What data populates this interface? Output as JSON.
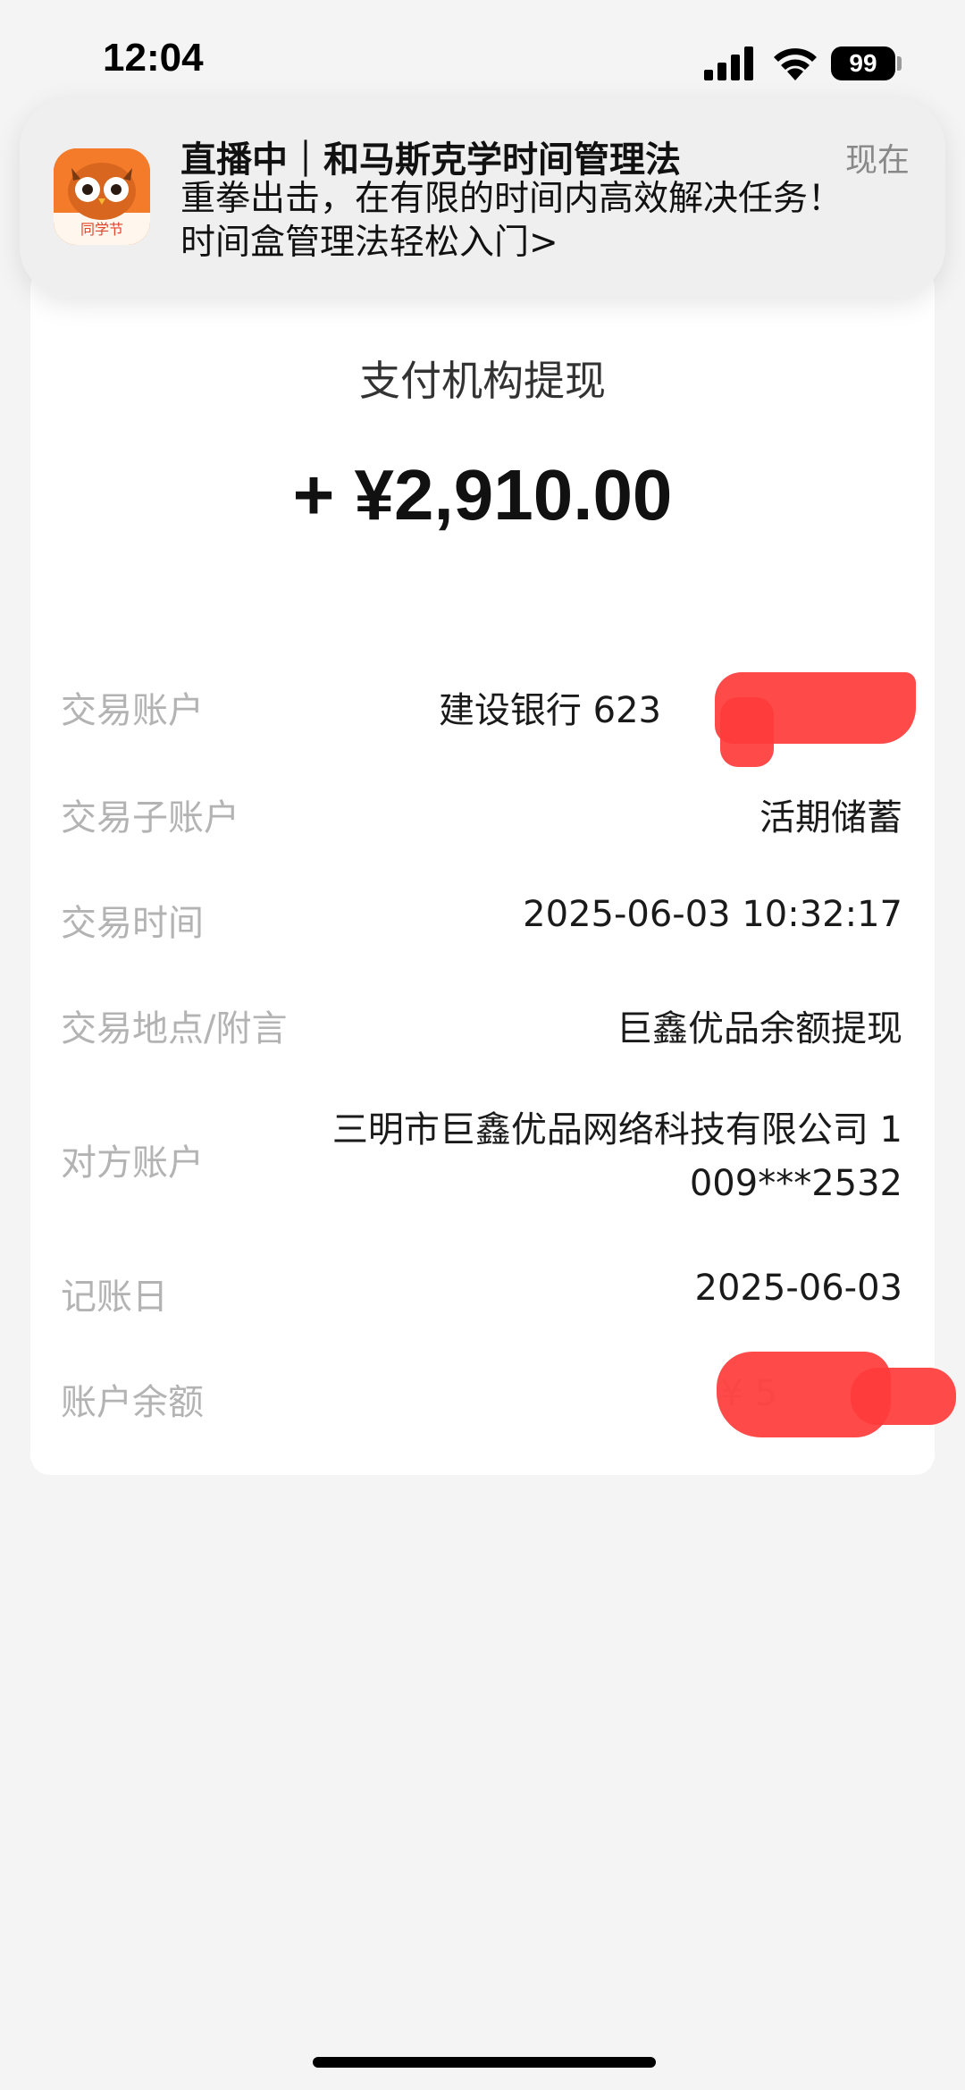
{
  "status_bar": {
    "time": "12:04",
    "battery": "99",
    "icons": [
      "signal-icon",
      "wifi-icon",
      "battery-icon"
    ]
  },
  "notification": {
    "title": "直播中｜和马斯克学时间管理法",
    "time": "现在",
    "body_line1": "重拳出击，在有限的时间内高效解决任务！",
    "body_line2": "时间盒管理法轻松入门>",
    "app_icon": "owl-app-icon",
    "app_icon_text": "同学节"
  },
  "detail": {
    "title": "支付机构提现",
    "amount": "+ ¥2,910.00",
    "rows": [
      {
        "label": "交易账户",
        "value": "建设银行 623"
      },
      {
        "label": "交易子账户",
        "value": "活期储蓄"
      },
      {
        "label": "交易时间",
        "value": "2025-06-03 10:32:17"
      },
      {
        "label": "交易地点/附言",
        "value": "巨鑫优品余额提现"
      },
      {
        "label": "对方账户",
        "value_line1": "三明市巨鑫优品网络科技有限公司 1",
        "value_line2": "009***2532"
      },
      {
        "label": "记账日",
        "value": "2025-06-03"
      },
      {
        "label": "账户余额",
        "value": "¥ 5"
      }
    ]
  },
  "colors": {
    "background": "#f4f4f4",
    "card": "#ffffff",
    "label": "#b3b3b3",
    "redaction": "#ff3b3b",
    "app_icon": "#f37b2a"
  }
}
